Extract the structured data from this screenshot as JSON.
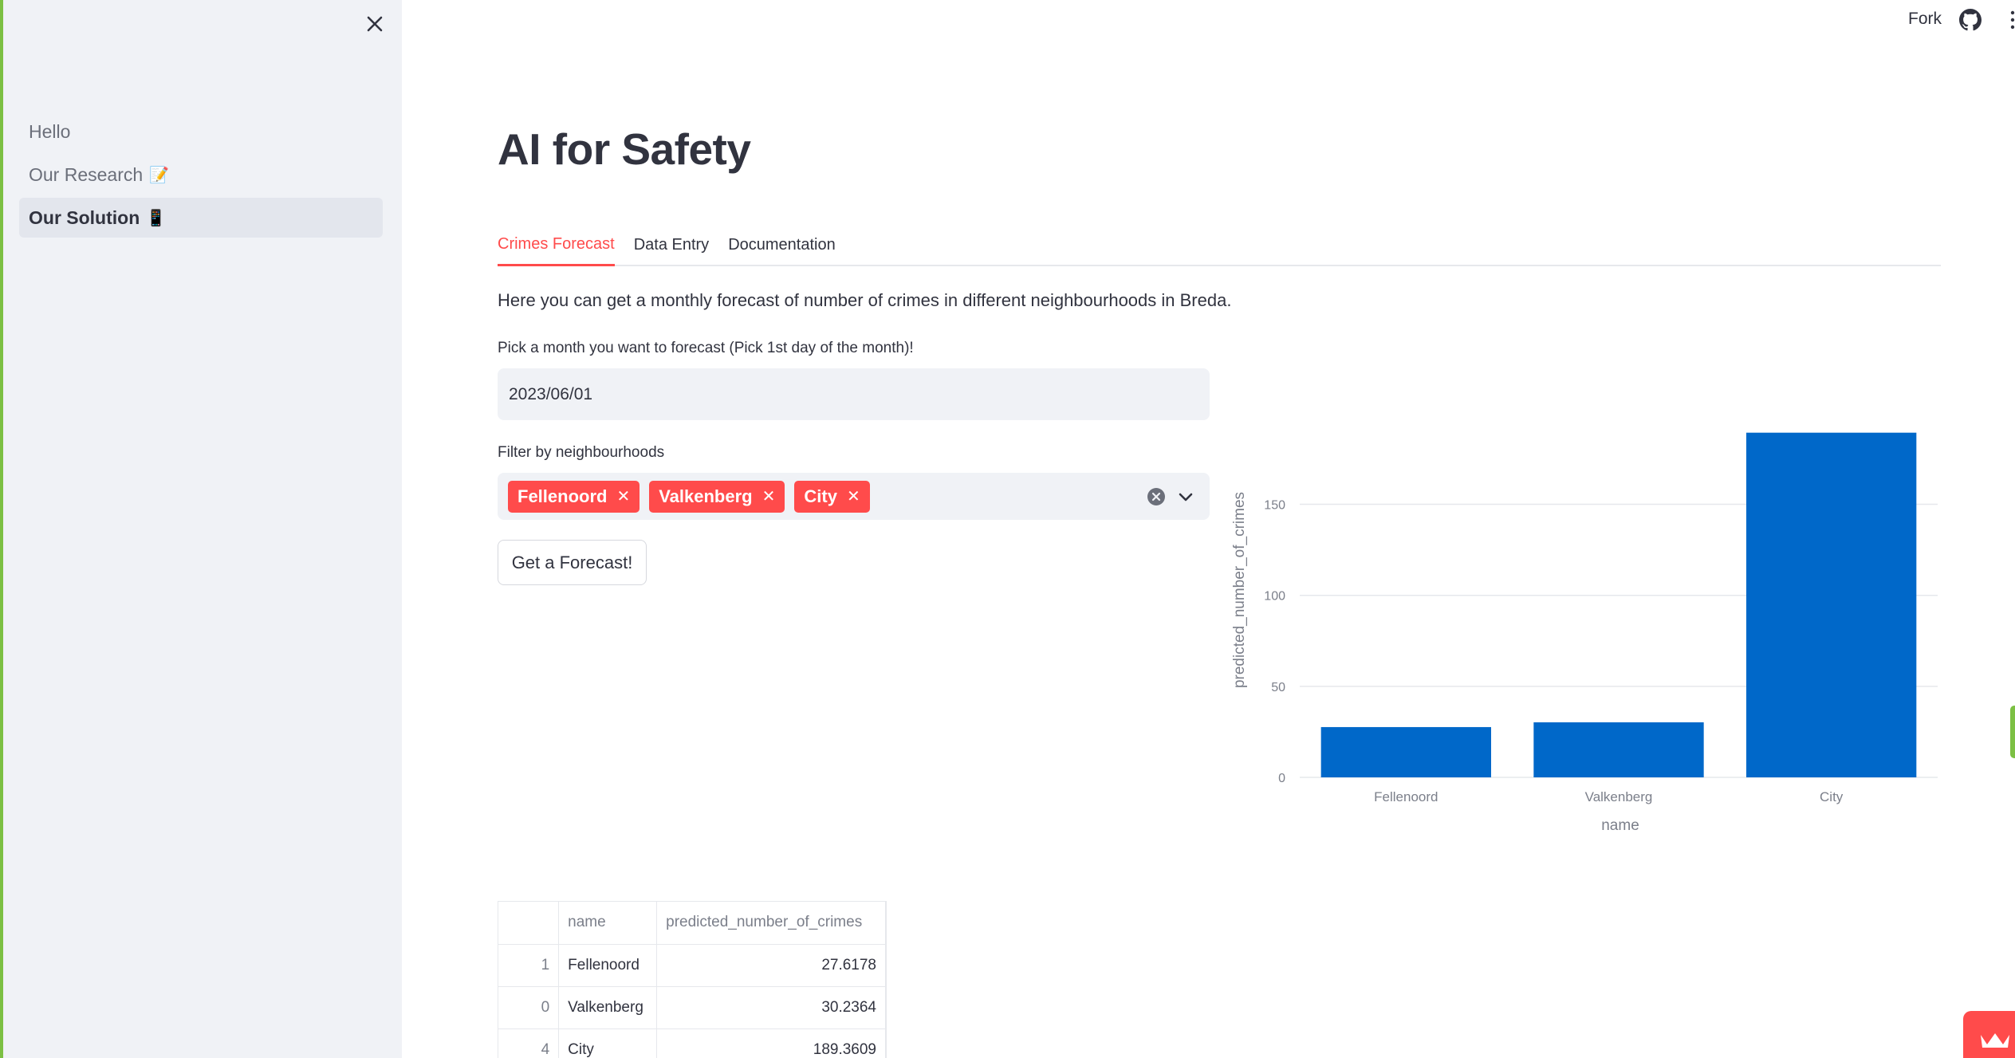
{
  "sidebar": {
    "items": [
      {
        "label": "Hello",
        "emoji": ""
      },
      {
        "label": "Our Research",
        "emoji": "📝"
      },
      {
        "label": "Our Solution",
        "emoji": "📱"
      }
    ],
    "active_index": 2
  },
  "header": {
    "fork_label": "Fork"
  },
  "main": {
    "title": "AI for Safety",
    "tabs": [
      {
        "label": "Crimes Forecast",
        "active": true
      },
      {
        "label": "Data Entry",
        "active": false
      },
      {
        "label": "Documentation",
        "active": false
      }
    ],
    "intro": "Here you can get a monthly forecast of number of crimes in different neighbourhoods in Breda.",
    "date_label": "Pick a month you want to forecast (Pick 1st day of the month)!",
    "date_value": "2023/06/01",
    "filter_label": "Filter by neighbourhoods",
    "chips": [
      "Fellenoord",
      "Valkenberg",
      "City"
    ],
    "forecast_button": "Get a Forecast!"
  },
  "chart_data": {
    "type": "bar",
    "categories": [
      "Fellenoord",
      "Valkenberg",
      "City"
    ],
    "values": [
      27.6178,
      30.2364,
      189.3609
    ],
    "xlabel": "name",
    "ylabel": "predicted_number_of_crimes",
    "yticks": [
      0,
      50,
      100,
      150
    ],
    "ylim": [
      0,
      199.3
    ],
    "bar_color": "#0068c9",
    "grid": true
  },
  "table": {
    "columns": [
      "",
      "name",
      "predicted_number_of_crimes"
    ],
    "rows": [
      {
        "index": "1",
        "name": "Fellenoord",
        "value": "27.6178"
      },
      {
        "index": "0",
        "name": "Valkenberg",
        "value": "30.2364"
      },
      {
        "index": "4",
        "name": "City",
        "value": "189.3609"
      }
    ]
  },
  "colors": {
    "accent": "#ff4b4b",
    "sidebar_bg": "#f0f2f6",
    "stripe": "#7cc043"
  }
}
